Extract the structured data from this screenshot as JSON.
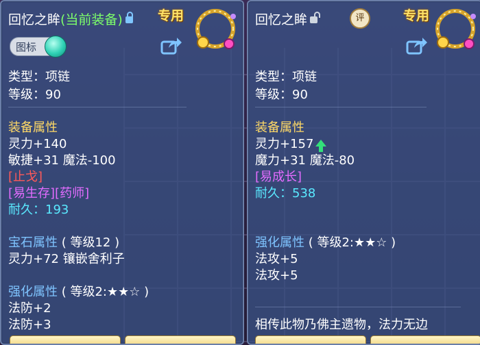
{
  "left": {
    "title": "回忆之眸",
    "equipped": "(当前装备)",
    "exclusive": "专用",
    "toggle_label": "图标",
    "type": "类型：项链",
    "level": "等级：90",
    "equip_attr_header": "装备属性",
    "attr1": "灵力+140",
    "attr2": "敏捷+31 魔法-100",
    "special1": "[止戈]",
    "special2": "[易生存][药师]",
    "durability_label": "耐久：",
    "durability_value": "193",
    "gem_header": "宝石属性",
    "gem_level": "( 等级12 )",
    "gem_attr": "灵力+72 镶嵌舍利子",
    "enh_header": "强化属性",
    "enh_level": "( 等级2:★★☆ )",
    "enh1": "法防+2",
    "enh2": "法防+3"
  },
  "right": {
    "title": "回忆之眸",
    "rate": "评",
    "exclusive": "专用",
    "type": "类型：项链",
    "level": "等级：90",
    "equip_attr_header": "装备属性",
    "attr1": "灵力+157",
    "attr2": "魔力+31 魔法-80",
    "special1": "[易成长]",
    "durability_label": "耐久：",
    "durability_value": "538",
    "enh_header": "强化属性",
    "enh_level": "( 等级2:★★☆ )",
    "enh1": "法攻+5",
    "enh2": "法攻+5",
    "description": "相传此物乃佛主遗物，法力无边"
  },
  "icons": {
    "lock_left": "lock-icon",
    "lock_right": "unlock-icon",
    "share": "share-icon",
    "necklace": "necklace-icon",
    "upgrade_arrow": "arrow-up-icon"
  },
  "colors": {
    "panel": "#3a5284",
    "gold": "#ffd966",
    "section": "#7fc4ff",
    "green_equipped": "#7dff6a",
    "red": "#ff5a5a",
    "pink": "#e36cff",
    "cyan": "#5ae9ff"
  }
}
